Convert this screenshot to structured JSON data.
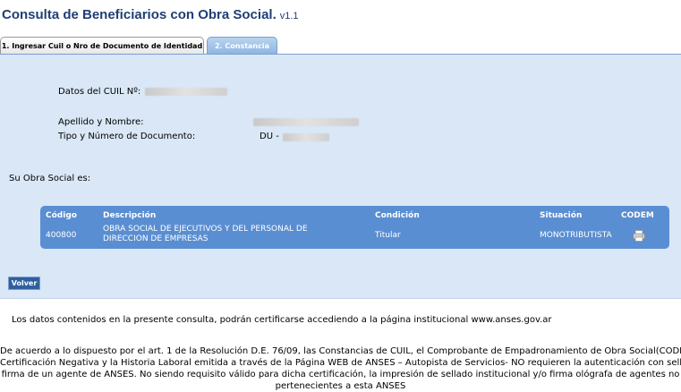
{
  "header": {
    "title": "Consulta de Beneficiarios con Obra Social.",
    "version": "v1.1"
  },
  "tabs": [
    {
      "label": "1. Ingresar Cuil o Nro de Documento de Identidad"
    },
    {
      "label": "2. Constancia"
    }
  ],
  "form": {
    "cuil_label": "Datos del CUIL Nº:",
    "name_label": "Apellido y Nombre:",
    "doc_label": "Tipo y Número de Documento:",
    "doc_prefix": "DU -",
    "obra_label": "Su Obra Social es:"
  },
  "table": {
    "headers": {
      "codigo": "Código",
      "descripcion": "Descripción",
      "condicion": "Condición",
      "situacion": "Situación",
      "codem": "CODEM"
    },
    "row": {
      "codigo": "400800",
      "descripcion_1": "OBRA SOCIAL DE EJECUTIVOS Y DEL PERSONAL DE",
      "descripcion_2": "DIRECCION DE EMPRESAS",
      "condicion": "Titular",
      "situacion": "MONOTRIBUTISTA",
      "codem_icon": "printer-icon"
    }
  },
  "buttons": {
    "volver": "Volver"
  },
  "footer": {
    "info": "Los datos contenidos en la presente consulta, podrán certificarse accediendo a la página institucional www.anses.gov.ar",
    "legal_1": "De acuerdo a lo dispuesto por el art. 1 de la Resolución D.E. 76/09, las Constancias de CUIL, el Comprobante de Empadronamiento de Obra Social(CODEM),",
    "legal_2": "Certificación Negativa y la Historia Laboral emitida a través de la Página WEB de ANSES – Autopista de Servicios- NO requieren la autenticación con sello y",
    "legal_3": "firma de un agente de ANSES. No siendo requisito válido para dicha certificación, la impresión de sellado institucional y/o firma ológrafa de agentes no",
    "legal_4": "pertenecientes a esta ANSES"
  },
  "colors": {
    "accent": "#5a8ed2",
    "title": "#1f3f74",
    "panel": "#d9e7f6"
  }
}
